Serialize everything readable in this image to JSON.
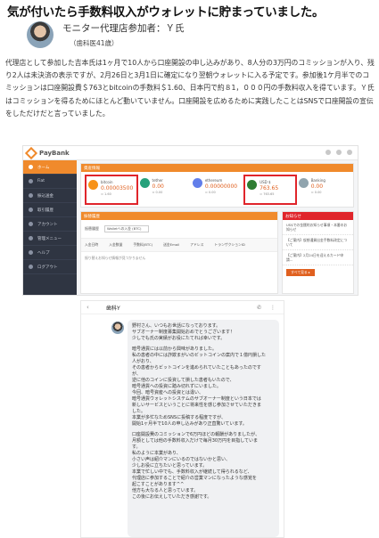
{
  "headline": "気が付いたら手数料収入がウォレットに貯まっていました。",
  "author": {
    "name": "モニター代理店参加者：Ｙ氏",
    "meta": "（歯科医41歳）"
  },
  "paragraph": "代理店として参加した吉本氏は1ヶ月で10人から口座開設の申し込みがあり、8人分の3万円のコミッションが入り、残り2人は未決済の表示ですが、2月26日と3月1日に確定になり翌朝ウォレットに入る予定です。参加後1ケ月半でのコミッションは口座開設費＄763とbitcoinの手数料＄1.60、日本円で約８1，０００円の手数料収入を得ています。Ｙ氏はコミッションを得るためにほとんど動いていません。口座開設を広めるために実践したことはSNSで口座開設の宣伝をしただけだと言っていました。",
  "dashboard": {
    "logo": "PayBank",
    "sidebar": [
      "ホーム",
      "Fiat",
      "振込送金",
      "取引履歴",
      "アカウント",
      "管理メニュー",
      "ヘルプ",
      "ログアウト"
    ],
    "assets_title": "資産情報",
    "assets": [
      {
        "name": "bitcoin",
        "value": "0.00003500",
        "sub": "≈ 1.60",
        "color": "#f7931a",
        "highlight": true
      },
      {
        "name": "tether",
        "value": "0.00",
        "sub": "≈ 0.00",
        "color": "#26a17b",
        "highlight": false
      },
      {
        "name": "ethereum",
        "value": "0.00000000",
        "sub": "≈ 0.00",
        "color": "#627eea",
        "highlight": false
      },
      {
        "name": "USD $",
        "value": "763.65",
        "sub": "≈ 763.65",
        "color": "#2e7d32",
        "highlight": true
      },
      {
        "name": "Banking",
        "value": "0.00",
        "sub": "≈ 0.00",
        "color": "#90a4ae",
        "highlight": false
      }
    ],
    "deposit_title": "振替履歴",
    "deposit_label": "振替履歴",
    "deposit_select": "Walletへの入金 (BTC)",
    "deposit_columns": [
      "入金日時",
      "入金数量",
      "手数料(BTC)",
      "送金Email",
      "アドレス",
      "トランザクションID"
    ],
    "deposit_empty": "振り替えお知らせ情報が見つかりません",
    "notice_title": "お知らせ",
    "notices": [
      "US$での金銭的お知らせ事項・本番のお知らせ",
      "【ご案内】仮想通貨出金手数料改定について",
      "【ご案内】2月24日を迎えるカード申請..."
    ],
    "notice_button": "すべて見る ▸"
  },
  "chat": {
    "title": "歯科Y",
    "icons": "✆ ⋮",
    "lines": [
      "野村さん、いつもお世話になっております。",
      "サブオーナー制度募集開始おめでとうございます！",
      "少しでも氏の実績がお役にたてれば幸いです。",
      "",
      "暗号通貨には以前から興味がありました。",
      "私の患者の中には詐欺まがいのビットコインの案内で１億円損した",
      "人がおり、",
      "その患者からビットコインを進められていたこともあったのです",
      "が、",
      "逆に他のコインに投資して損した患者もいたので、",
      "暗号通貨への投資に踏み切れずにいました。",
      "今回、暗号資産への投資とは違い、",
      "暗号通貨ウォレットシステムのサブオーナー制度という日本では",
      "新しいサービスということに将来性を感じ参加させていただきま",
      "した。",
      "本業が多忙なためSNSに投稿する程度ですが、",
      "開始1ヶ月半で10人の申し込みがあり正直驚いています。",
      "",
      "口座開設費のコミッションで6万円ほどの報酬がありましたが、",
      "月額としては他の手数料収入だけで毎月30万円を目指していま",
      "す。",
      "私のように本業があり、",
      "小さい声は紹介マンにいるのではないかと思い、",
      "少しお役に立ちたいと思っています。",
      "本業で忙しい中でも、手数料収入が継続して得られるなど、",
      "代理店に参加することで紹介の営業マンになったような感覚を",
      "起こすことがあります^^",
      "他方も大なる人と思っています。",
      "この後にお伝えしていただき感謝です。"
    ]
  }
}
